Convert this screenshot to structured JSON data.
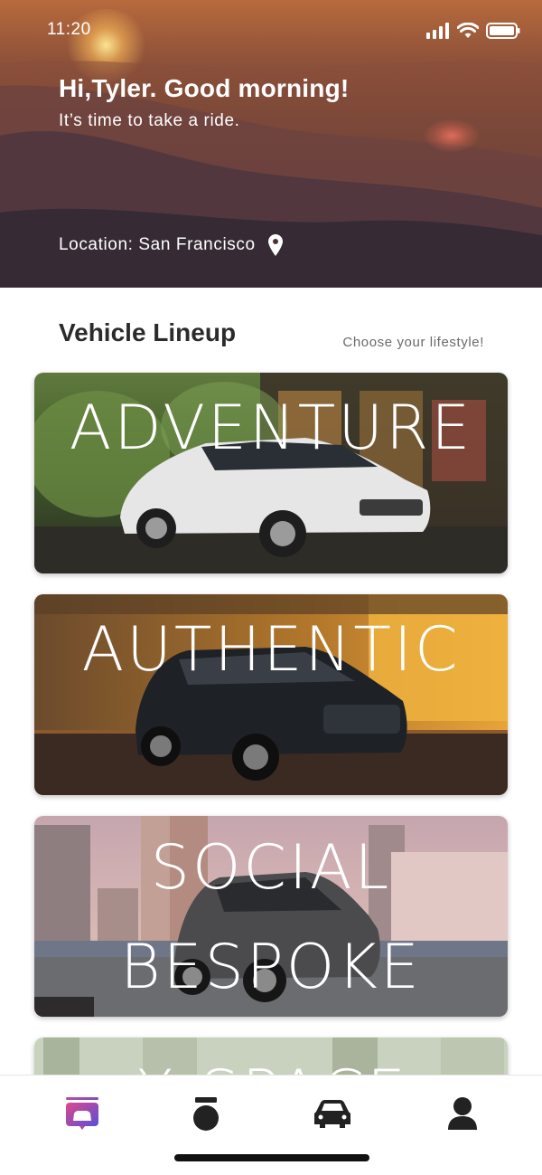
{
  "status_bar": {
    "time": "11:20"
  },
  "hero": {
    "greeting": "Hi,Tyler. Good morning!",
    "subtitle": "It’s time to take a ride.",
    "location_text": "Location: San Francisco",
    "location_icon": "location-pin-icon"
  },
  "lineup": {
    "title": "Vehicle Lineup",
    "subtitle": "Choose your lifestyle!",
    "cards": [
      {
        "label": "ADVENTURE"
      },
      {
        "label": "AUTHENTIC"
      },
      {
        "label_line1": "SOCIAL",
        "label_line2": "BESPOKE"
      },
      {
        "label": "X-SPACE"
      }
    ]
  },
  "tab_bar": {
    "tabs": [
      {
        "icon": "vehicle-lineup-icon",
        "active": true
      },
      {
        "icon": "orb-icon",
        "active": false
      },
      {
        "icon": "car-icon",
        "active": false
      },
      {
        "icon": "profile-icon",
        "active": false
      }
    ],
    "active_color": "#7a4fd6"
  }
}
